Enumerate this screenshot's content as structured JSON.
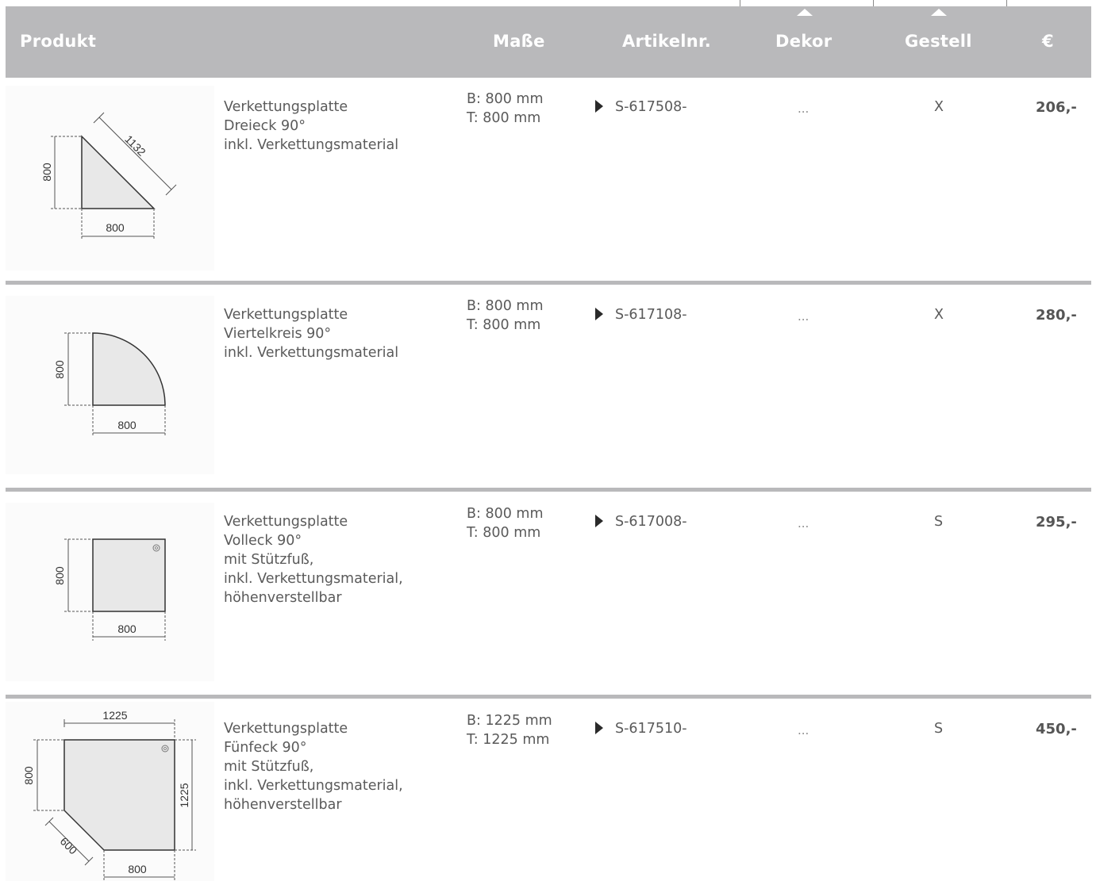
{
  "header": {
    "produkt": "Produkt",
    "masse": "Maße",
    "artikelnr": "Artikelnr.",
    "dekor": "Dekor",
    "gestell": "Gestell",
    "preis": "€"
  },
  "rows": [
    {
      "shape": "triangle",
      "desc": [
        "Verkettungsplatte",
        "Dreieck 90°",
        "inkl. Verkettungsmaterial"
      ],
      "dims": [
        "B: 800 mm",
        "T: 800 mm"
      ],
      "artnr": "S-617508-",
      "dekor": "...",
      "gestell": "X",
      "price": "206,-",
      "drawing": {
        "w": "800",
        "h": "800",
        "diag": "1132"
      }
    },
    {
      "shape": "quarter-circle",
      "desc": [
        "Verkettungsplatte",
        "Viertelkreis 90°",
        "inkl. Verkettungsmaterial"
      ],
      "dims": [
        "B: 800 mm",
        "T: 800 mm"
      ],
      "artnr": "S-617108-",
      "dekor": "...",
      "gestell": "X",
      "price": "280,-",
      "drawing": {
        "w": "800",
        "h": "800"
      }
    },
    {
      "shape": "square",
      "desc": [
        "Verkettungsplatte",
        "Volleck 90°",
        "mit Stützfuß,",
        "inkl. Verkettungsmaterial,",
        "höhenverstellbar"
      ],
      "dims": [
        "B: 800 mm",
        "T: 800 mm"
      ],
      "artnr": "S-617008-",
      "dekor": "...",
      "gestell": "S",
      "price": "295,-",
      "drawing": {
        "w": "800",
        "h": "800"
      }
    },
    {
      "shape": "pentagon",
      "desc": [
        "Verkettungsplatte",
        "Fünfeck 90°",
        "mit Stützfuß,",
        "inkl. Verkettungsmaterial,",
        "höhenverstellbar"
      ],
      "dims": [
        "B: 1225 mm",
        "T: 1225 mm"
      ],
      "artnr": "S-617510-",
      "dekor": "...",
      "gestell": "S",
      "price": "450,-",
      "drawing": {
        "top": "1225",
        "left": "800",
        "right": "1225",
        "bottom": "800",
        "diag": "600"
      }
    }
  ]
}
